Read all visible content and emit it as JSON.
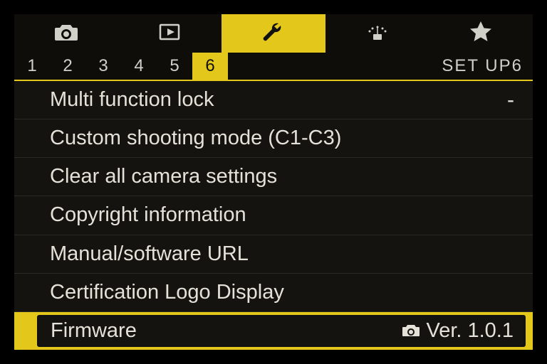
{
  "tabs": {
    "active_index": 2,
    "icons": [
      "camera",
      "play",
      "wrench",
      "network",
      "star"
    ]
  },
  "pages": {
    "numbers": [
      "1",
      "2",
      "3",
      "4",
      "5",
      "6"
    ],
    "active": "6",
    "section_label": "SET  UP6"
  },
  "menu": {
    "items": [
      {
        "label": "Multi function lock",
        "value": "-"
      },
      {
        "label": "Custom shooting mode (C1-C3)",
        "value": ""
      },
      {
        "label": "Clear all camera settings",
        "value": ""
      },
      {
        "label": "Copyright information",
        "value": ""
      },
      {
        "label": "Manual/software URL",
        "value": ""
      },
      {
        "label": "Certification Logo Display",
        "value": ""
      },
      {
        "label": "Firmware",
        "value": "Ver. 1.0.1",
        "value_icon": "camera",
        "selected": true
      }
    ]
  }
}
